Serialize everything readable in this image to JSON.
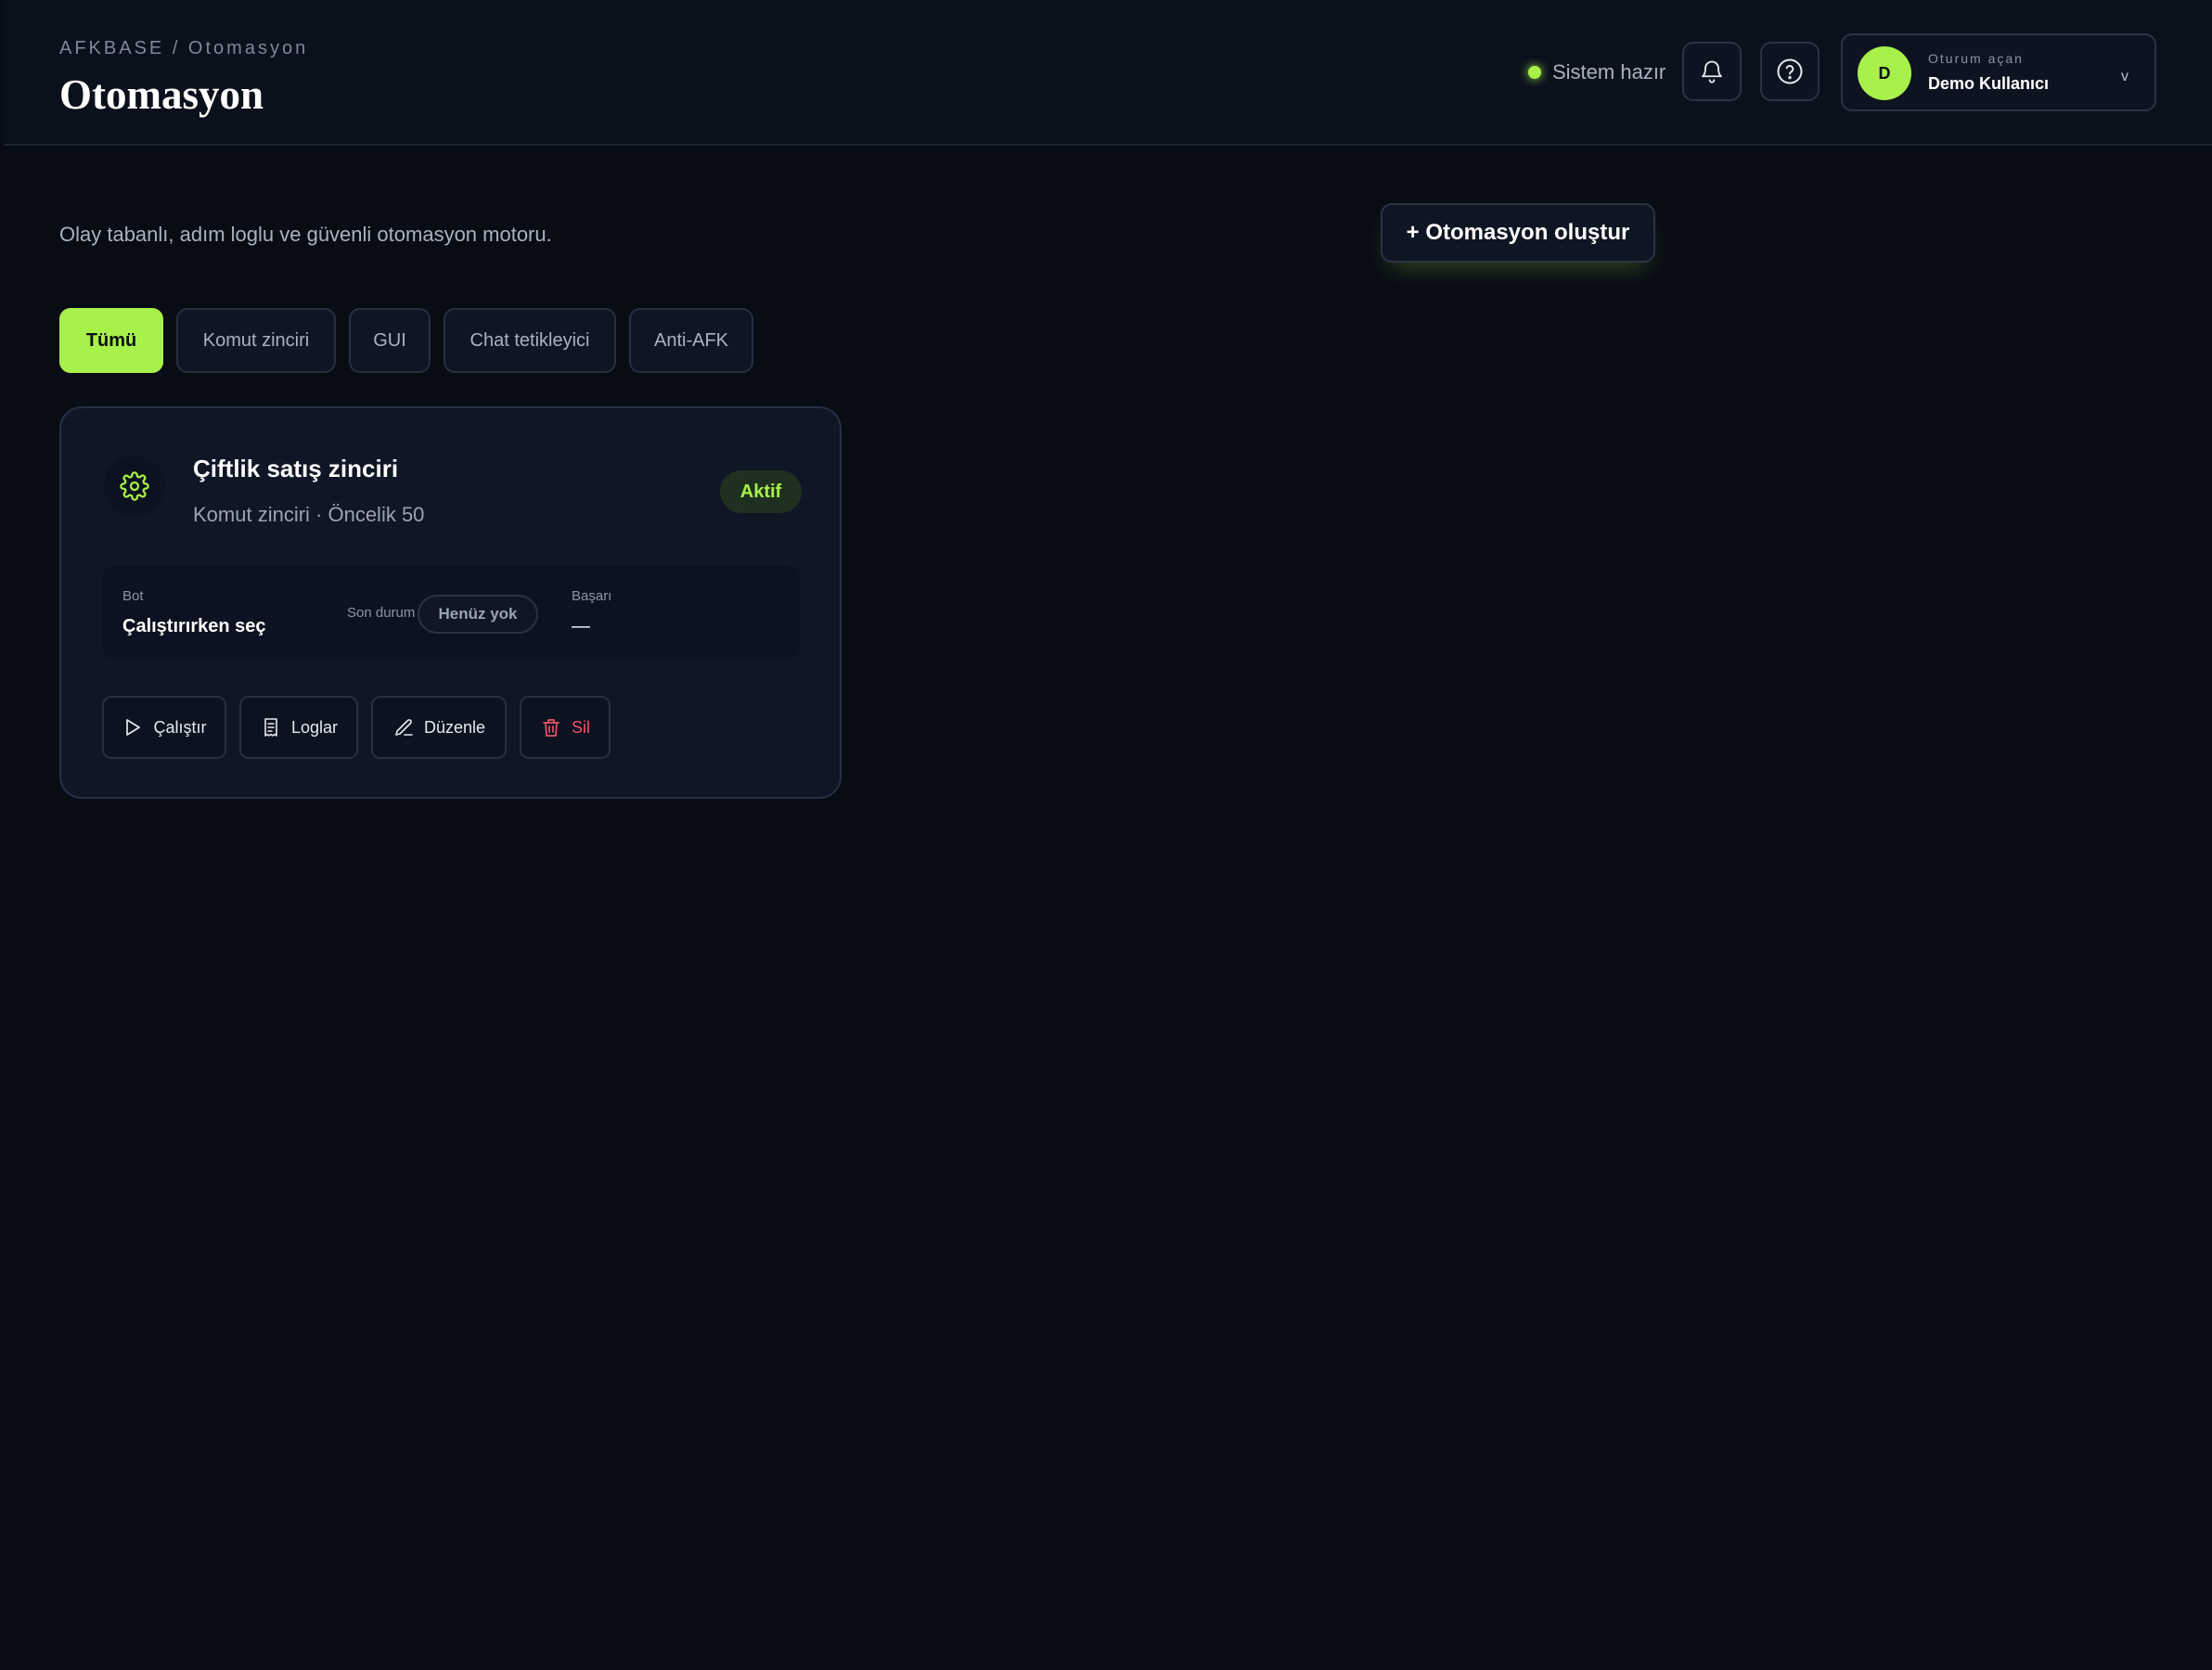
{
  "header": {
    "breadcrumb": "AFKBASE / Otomasyon",
    "title": "Otomasyon",
    "status_text": "Sistem hazır",
    "user": {
      "caption": "Oturum açan",
      "name": "Demo Kullanıcı",
      "avatar_initial": "D",
      "chevron": "v"
    },
    "icons": [
      "bell-icon",
      "help-icon"
    ]
  },
  "main": {
    "subtitle": "Olay tabanlı, adım loglu ve güvenli otomasyon motoru.",
    "create_button": "+ Otomasyon oluştur",
    "tabs": [
      {
        "label": "Tümü",
        "active": true
      },
      {
        "label": "Komut zinciri",
        "active": false
      },
      {
        "label": "GUI",
        "active": false
      },
      {
        "label": "Chat tetikleyici",
        "active": false
      },
      {
        "label": "Anti-AFK",
        "active": false
      }
    ],
    "card": {
      "icon": "gear-icon",
      "title": "Çiftlik satış zinciri",
      "meta": "Komut zinciri · Öncelik 50",
      "badge": "Aktif",
      "bot_label": "Bot",
      "bot_value": "Çalıştırırken seç",
      "last_status_label": "Son durum",
      "last_status_value": "Henüz yok",
      "success_label": "Başarı",
      "success_value": "—",
      "actions": [
        {
          "label": "Çalıştır",
          "icon": "play-icon"
        },
        {
          "label": "Loglar",
          "icon": "log-icon"
        },
        {
          "label": "Düzenle",
          "icon": "pencil-icon"
        },
        {
          "label": "Sil",
          "icon": "trash-icon"
        }
      ]
    }
  },
  "colors": {
    "accent": "#a8f04a",
    "background": "#080c14",
    "danger": "#f0506a"
  }
}
